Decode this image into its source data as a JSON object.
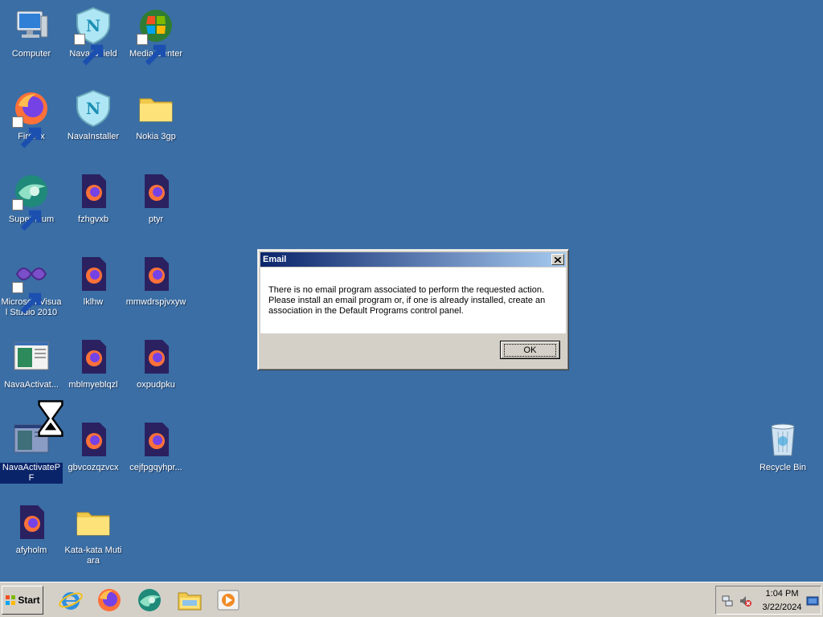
{
  "desktop": {
    "icons": [
      {
        "label": "Computer"
      },
      {
        "label": "Nava Shield"
      },
      {
        "label": "Media Center"
      },
      {
        "label": "Firefox"
      },
      {
        "label": "NavaInstaller"
      },
      {
        "label": "Nokia 3gp"
      },
      {
        "label": "Supermium"
      },
      {
        "label": "fzhgvxb"
      },
      {
        "label": "ptyr"
      },
      {
        "label": "Microsoft Visual Studio 2010"
      },
      {
        "label": "lklhw"
      },
      {
        "label": "mmwdrspjvxyw"
      },
      {
        "label": "NavaActivat..."
      },
      {
        "label": "mblmyeblqzl"
      },
      {
        "label": "oxpudpku"
      },
      {
        "label": "NavaActivatePF"
      },
      {
        "label": "gbvcozqzvcx"
      },
      {
        "label": "cejfpgqyhpr..."
      },
      {
        "label": "afyholm"
      },
      {
        "label": "Kata-kata Mutiara"
      },
      {
        "label": "Recycle Bin"
      }
    ]
  },
  "dialog": {
    "title": "Email",
    "message": "There is no email program associated to perform the requested action. Please install an email program or, if one is already installed, create an association in the Default Programs control panel.",
    "ok_label": "OK"
  },
  "taskbar": {
    "start_label": "Start",
    "quick_launch": [
      "ie-icon",
      "firefox-icon",
      "supermium-icon",
      "explorer-folder-icon",
      "media-player-icon"
    ],
    "clock_time": "1:04 PM",
    "clock_date": "3/22/2024"
  },
  "colors": {
    "desktop": "#3a6ea5",
    "title_start": "#0a246a",
    "title_end": "#a6caf0",
    "face": "#d4d0c8"
  }
}
